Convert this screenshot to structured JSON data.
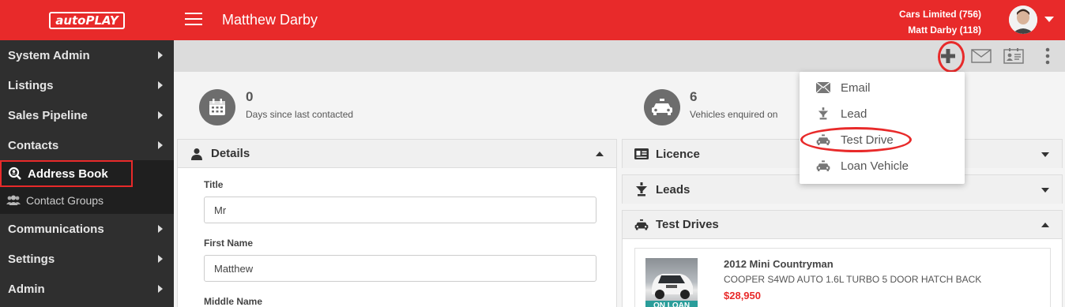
{
  "app": {
    "logo_text": "autoPLAY",
    "brand_color": "#e82a2a"
  },
  "header": {
    "title": "Matthew Darby",
    "account_line1": "Cars Limited (756)",
    "account_line2": "Matt Darby (118)"
  },
  "sidebar": {
    "items": [
      {
        "label": "System Admin",
        "has_arrow": true
      },
      {
        "label": "Listings",
        "has_arrow": true
      },
      {
        "label": "Sales Pipeline",
        "has_arrow": true
      },
      {
        "label": "Contacts",
        "has_arrow": true
      }
    ],
    "sub_items": [
      {
        "label": "Address Book",
        "icon": "search-user-icon",
        "active": true
      },
      {
        "label": "Contact Groups",
        "icon": "users-icon",
        "active": false
      }
    ],
    "items_after": [
      {
        "label": "Communications",
        "has_arrow": true
      },
      {
        "label": "Settings",
        "has_arrow": true
      },
      {
        "label": "Admin",
        "has_arrow": true
      }
    ]
  },
  "toolbar": {
    "icons": [
      "plus-icon",
      "envelope-icon",
      "contact-card-icon",
      "more-vertical-icon"
    ]
  },
  "stats": [
    {
      "value": "0",
      "label": "Days since last contacted",
      "icon": "calendar-icon"
    },
    {
      "value": "6",
      "label": "Vehicles enquired on",
      "icon": "car-icon"
    }
  ],
  "details": {
    "heading": "Details",
    "fields": [
      {
        "label": "Title",
        "value": "Mr"
      },
      {
        "label": "First Name",
        "value": "Matthew"
      },
      {
        "label": "Middle Name",
        "value": ""
      }
    ]
  },
  "right_panels": {
    "licence": "Licence",
    "leads": "Leads",
    "test_drives": "Test Drives"
  },
  "vehicle": {
    "title": "2012 Mini Countryman",
    "description": "COOPER S4WD AUTO 1.6L TURBO 5 DOOR HATCH BACK",
    "price": "$28,950",
    "badge": "ON LOAN"
  },
  "add_menu": {
    "items": [
      {
        "label": "Email",
        "icon": "envelope-icon"
      },
      {
        "label": "Lead",
        "icon": "funnel-icon"
      },
      {
        "label": "Test Drive",
        "icon": "car-icon"
      },
      {
        "label": "Loan Vehicle",
        "icon": "car-icon"
      }
    ]
  }
}
